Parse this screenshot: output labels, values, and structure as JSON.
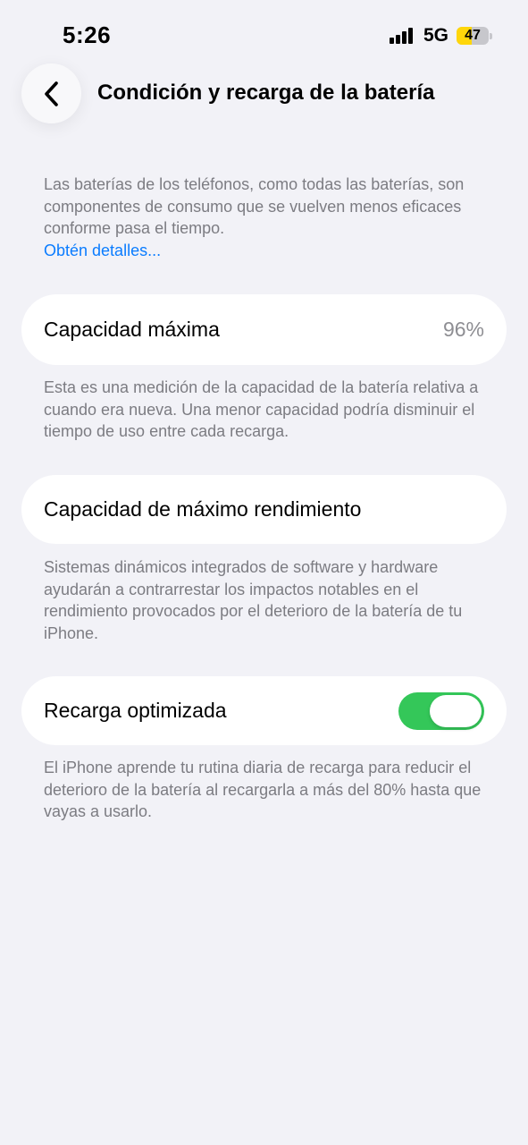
{
  "status_bar": {
    "time": "5:26",
    "network": "5G",
    "battery_level": "47",
    "battery_fraction": 0.47
  },
  "nav": {
    "title": "Condición y recarga de la batería",
    "back_icon": "chevron-left-icon"
  },
  "intro": {
    "text": "Las baterías de los teléfonos, como todas las baterías, son componentes de consumo que se vuelven menos eficaces conforme pasa el tiempo.",
    "link": "Obtén detalles..."
  },
  "max_capacity": {
    "label": "Capacidad máxima",
    "value": "96%",
    "description": "Esta es una medición de la capacidad de la batería relativa a cuando era nueva. Una menor capacidad podría disminuir el tiempo de uso entre cada recarga."
  },
  "peak_performance": {
    "label": "Capacidad de máximo rendimiento",
    "description": "Sistemas dinámicos integrados de software y hardware ayudarán a contrarrestar los impactos notables en el rendimiento provocados por el deterioro de la batería de tu iPhone."
  },
  "optimized_charging": {
    "label": "Recarga optimizada",
    "enabled": true,
    "description": "El iPhone aprende tu rutina diaria de recarga para reducir el deterioro de la batería al recargarla a más del 80% hasta que vayas a usarlo."
  },
  "colors": {
    "background": "#f2f2f7",
    "link": "#0a7cff",
    "toggle_on": "#34c759",
    "battery_fill": "#ffd60a"
  }
}
